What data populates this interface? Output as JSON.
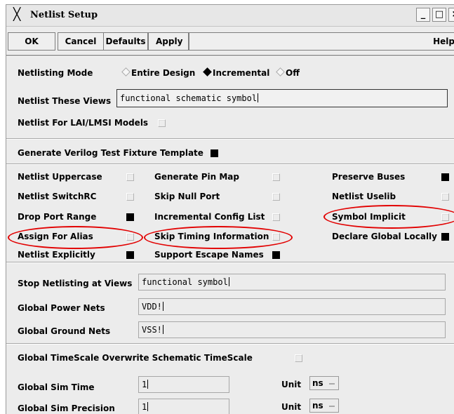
{
  "window": {
    "title": "Netlist Setup",
    "icon": "x-window-icon",
    "minimize": "_",
    "maximize": "□",
    "close": "×"
  },
  "toolbar": {
    "ok": "OK",
    "cancel": "Cancel",
    "defaults": "Defaults",
    "apply": "Apply",
    "help": "Help"
  },
  "mode": {
    "label": "Netlisting Mode",
    "options": [
      {
        "label": "Entire Design",
        "selected": false
      },
      {
        "label": "Incremental",
        "selected": true
      },
      {
        "label": "Off",
        "selected": false
      }
    ]
  },
  "views": {
    "label": "Netlist These Views",
    "value": "functional schematic symbol"
  },
  "lai": {
    "label": "Netlist For LAI/LMSI Models",
    "checked": false
  },
  "verilog": {
    "label": "Generate Verilog Test Fixture Template",
    "checked": true
  },
  "options": {
    "col1": [
      {
        "label": "Netlist Uppercase",
        "checked": false
      },
      {
        "label": "Netlist SwitchRC",
        "checked": false
      },
      {
        "label": "Drop Port Range",
        "checked": true
      },
      {
        "label": "Assign For Alias",
        "checked": false
      },
      {
        "label": "Netlist Explicitly",
        "checked": true
      }
    ],
    "col2": [
      {
        "label": "Generate Pin Map",
        "checked": false
      },
      {
        "label": "Skip Null Port",
        "checked": false
      },
      {
        "label": "Incremental Config List",
        "checked": false
      },
      {
        "label": "Skip Timing Information",
        "checked": false
      },
      {
        "label": "Support Escape Names",
        "checked": true
      }
    ],
    "col3": [
      {
        "label": "Preserve Buses",
        "checked": true
      },
      {
        "label": "Netlist Uselib",
        "checked": false
      },
      {
        "label": "Symbol Implicit",
        "checked": false
      },
      {
        "label": "Declare Global Locally",
        "checked": true
      }
    ]
  },
  "nets": {
    "stop_label": "Stop Netlisting at Views",
    "stop_value": "functional symbol",
    "power_label": "Global Power Nets",
    "power_value": "VDD!",
    "ground_label": "Global Ground Nets",
    "ground_value": "VSS!"
  },
  "timescale": {
    "overwrite_label": "Global TimeScale Overwrite Schematic TimeScale",
    "overwrite_checked": false,
    "sim_time_label": "Global Sim Time",
    "sim_time_value": "1",
    "sim_time_unit_label": "Unit",
    "sim_time_unit": "ns",
    "precision_label": "Global Sim Precision",
    "precision_value": "1",
    "precision_unit_label": "Unit",
    "precision_unit": "ns"
  },
  "annotation_color": "#e20000"
}
